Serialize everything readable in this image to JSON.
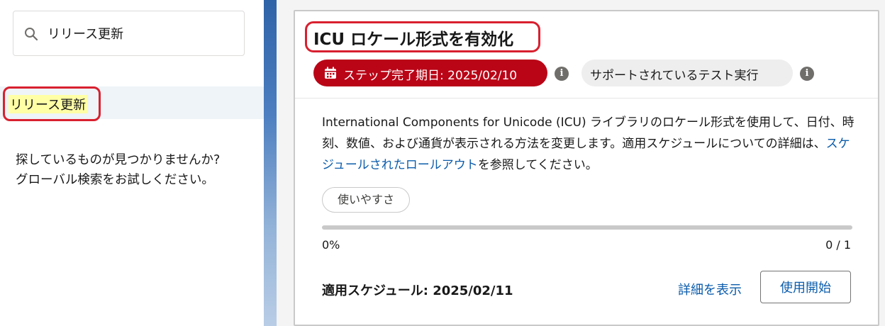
{
  "search": {
    "value": "リリース更新",
    "icon": "search-icon"
  },
  "sidebar": {
    "items": [
      {
        "label": "リリース更新",
        "selected": true
      }
    ],
    "not_found_line1": "探しているものが見つかりませんか?",
    "not_found_line2": "グローバル検索をお試しください。"
  },
  "card": {
    "title": "ICU ロケール形式を有効化",
    "due_badge": "ステップ完了期日: 2025/02/10",
    "due_badge_icon": "calendar-icon",
    "support_badge": "サポートされているテスト実行",
    "info_icon": "i",
    "description_before_link": "International Components for Unicode (ICU) ライブラリのロケール形式を使用して、日付、時刻、数値、および通貨が表示される方法を変更します。適用スケジュールについての詳細は、",
    "description_link": "スケジュールされたロールアウト",
    "description_after_link": "を参照してください。",
    "tag": "使いやすさ",
    "progress_percent": "0%",
    "progress_fraction": 0,
    "progress_count": "0 / 1",
    "schedule": "適用スケジュール: 2025/02/11",
    "details_link": "詳細を表示",
    "start_button": "使用開始"
  },
  "colors": {
    "accent_red": "#ba0517",
    "link_blue": "#0b5cab",
    "highlight_yellow": "#ffffa6",
    "annotation_red": "#d8202f"
  }
}
